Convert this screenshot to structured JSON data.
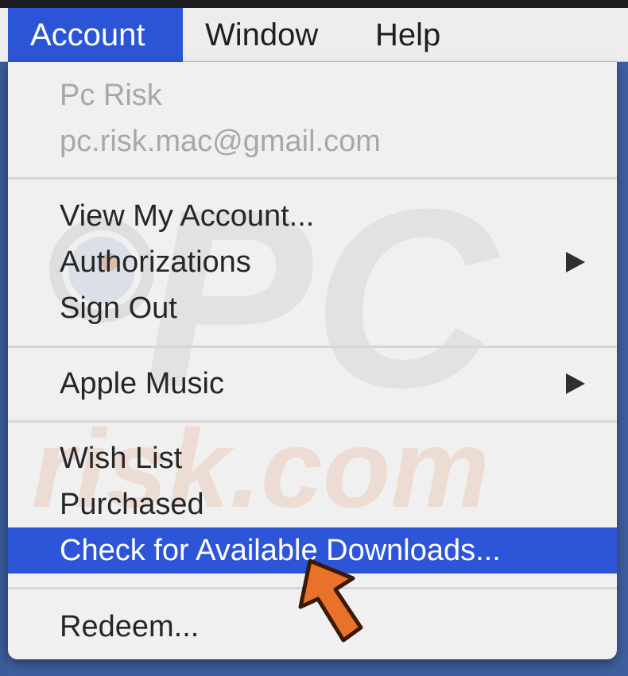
{
  "menubar": {
    "items": [
      {
        "label": "Account",
        "active": true
      },
      {
        "label": "Window",
        "active": false
      },
      {
        "label": "Help",
        "active": false
      }
    ]
  },
  "account_menu": {
    "user_name": "Pc Risk",
    "user_email": "pc.risk.mac@gmail.com",
    "view_my_account": "View My Account...",
    "authorizations": "Authorizations",
    "sign_out": "Sign Out",
    "apple_music": "Apple Music",
    "wish_list": "Wish List",
    "purchased": "Purchased",
    "check_downloads": "Check for Available Downloads...",
    "redeem": "Redeem..."
  },
  "watermark": {
    "line1": "PC",
    "line2": "risk.com"
  },
  "colors": {
    "highlight": "#2d55d8",
    "menubar_bg": "#ededed",
    "menu_bg": "#f0f0f0",
    "cursor_arrow": "#e8722a"
  },
  "icons": {
    "submenu": "triangle-right-icon",
    "pointer": "orange-arrow-cursor-icon"
  }
}
